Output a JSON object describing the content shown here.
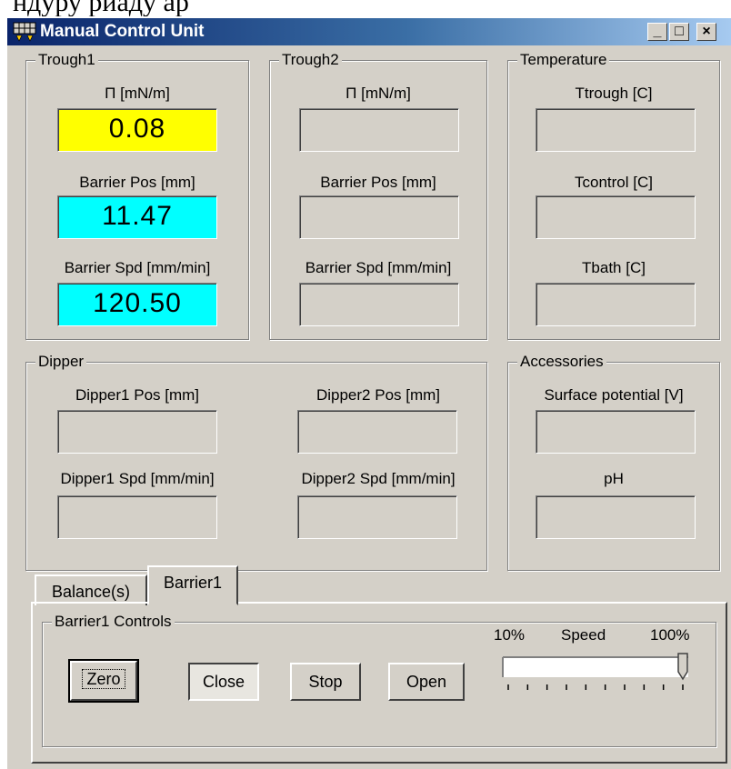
{
  "page_header_fragment": "ндуру          риаду          ар",
  "window": {
    "title": "Manual Control Unit",
    "minimize": "_",
    "maximize": "□",
    "close": "×"
  },
  "trough1": {
    "title": "Trough1",
    "pi_label": "Π  [mN/m]",
    "pi_value": "0.08",
    "barrier_pos_label": "Barrier Pos [mm]",
    "barrier_pos_value": "11.47",
    "barrier_spd_label": "Barrier Spd [mm/min]",
    "barrier_spd_value": "120.50",
    "colors": {
      "pi": "#ffff00",
      "pos": "#00ffff",
      "spd": "#00ffff"
    }
  },
  "trough2": {
    "title": "Trough2",
    "pi_label": "Π  [mN/m]",
    "pi_value": "",
    "barrier_pos_label": "Barrier Pos [mm]",
    "barrier_pos_value": "",
    "barrier_spd_label": "Barrier Spd [mm/min]",
    "barrier_spd_value": ""
  },
  "temperature": {
    "title": "Temperature",
    "ttrough_label": "Ttrough [C]",
    "tcontrol_label": "Tcontrol [C]",
    "tbath_label": "Tbath [C]"
  },
  "dipper": {
    "title": "Dipper",
    "dipper1_pos_label": "Dipper1 Pos [mm]",
    "dipper2_pos_label": "Dipper2 Pos [mm]",
    "dipper1_spd_label": "Dipper1 Spd [mm/min]",
    "dipper2_spd_label": "Dipper2 Spd [mm/min]"
  },
  "accessories": {
    "title": "Accessories",
    "surface_potential_label": "Surface potential [V]",
    "ph_label": "pH"
  },
  "tabs": [
    {
      "label": "Balance(s)",
      "active": false
    },
    {
      "label": "Barrier1",
      "active": true
    }
  ],
  "barrier1_controls": {
    "title": "Barrier1 Controls",
    "zero": "Zero",
    "close": "Close",
    "stop": "Stop",
    "open": "Open",
    "speed_min_label": "10%",
    "speed_label": "Speed",
    "speed_max_label": "100%",
    "speed_value_percent": 100,
    "tick_count": 10
  }
}
